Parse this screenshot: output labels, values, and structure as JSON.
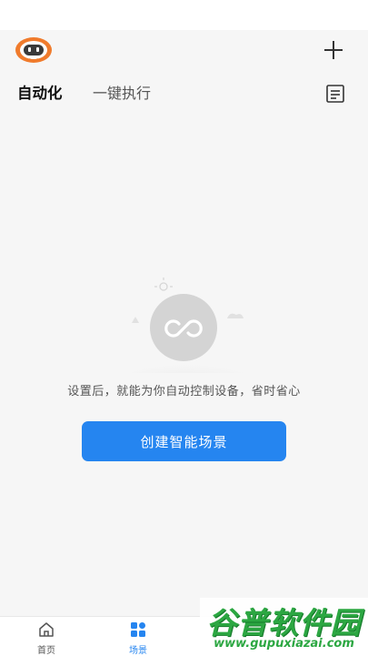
{
  "header": {
    "avatar_icon": "robot-avatar-icon",
    "add_icon": "plus-icon",
    "tabs": [
      {
        "label": "自动化",
        "active": true
      },
      {
        "label": "一键执行",
        "active": false
      }
    ],
    "doc_icon": "document-list-icon"
  },
  "empty_state": {
    "illustration_icon": "loop-sync-icon",
    "message": "设置后，就能为你自动控制设备，省时省心",
    "button_label": "创建智能场景"
  },
  "bottom_nav": {
    "items": [
      {
        "label": "首页",
        "icon": "home-icon",
        "active": false
      },
      {
        "label": "场景",
        "icon": "scene-grid-icon",
        "active": true
      }
    ]
  },
  "watermark": {
    "title": "谷普软件园",
    "url": "www.gupuxiazai.com"
  },
  "colors": {
    "accent": "#2585f0",
    "background": "#f6f6f6",
    "watermark": "#2ca742"
  }
}
